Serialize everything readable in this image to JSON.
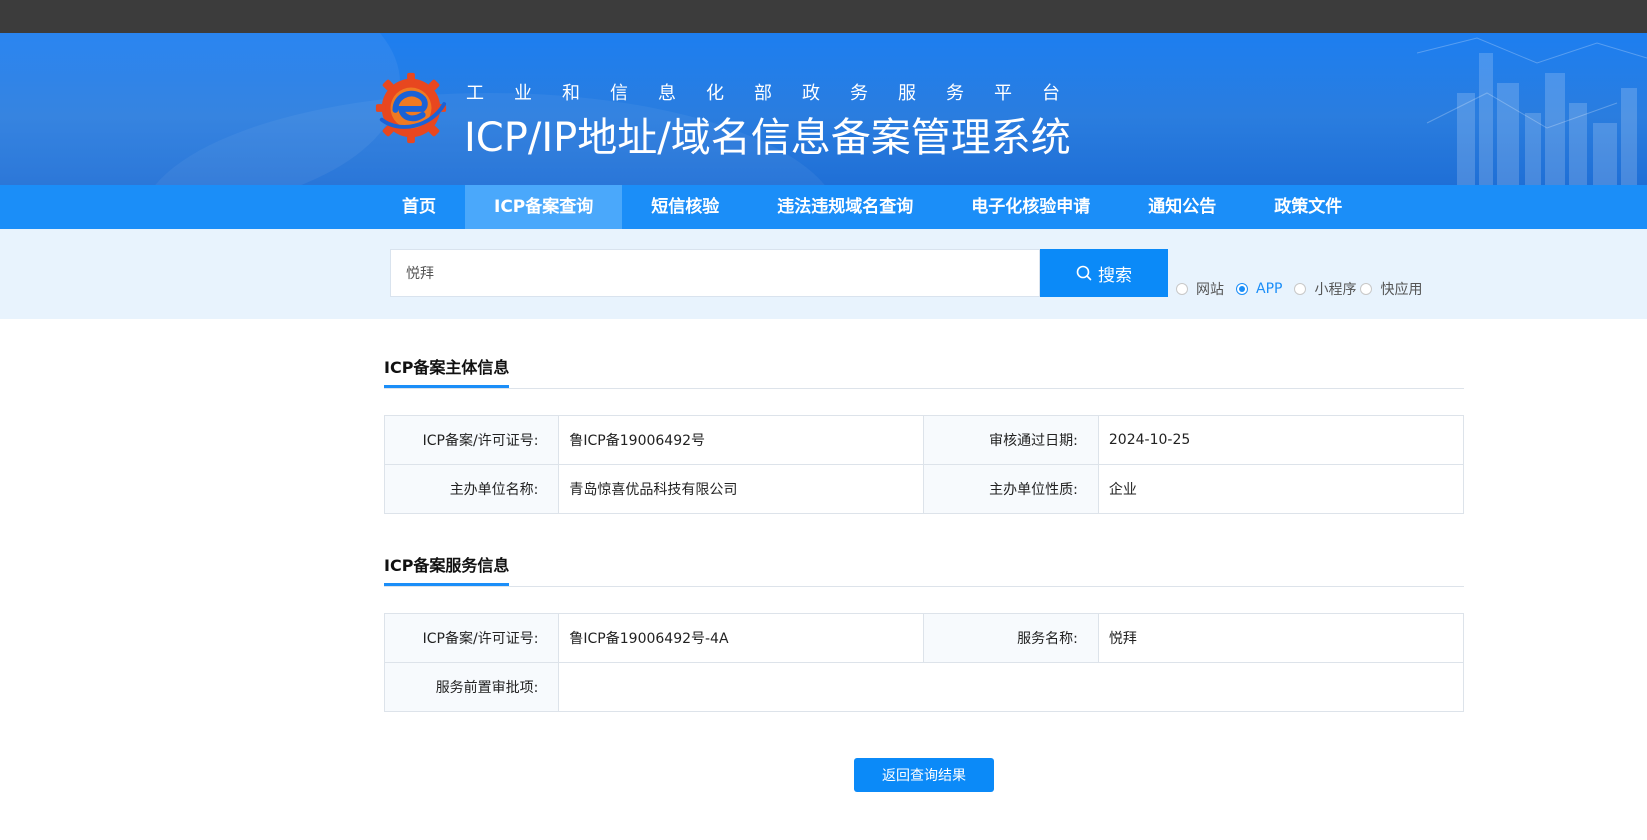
{
  "header": {
    "subtitle": "工业和信息化部政务服务平台",
    "title": "ICP/IP地址/域名信息备案管理系统"
  },
  "nav": {
    "items": [
      {
        "label": "首页"
      },
      {
        "label": "ICP备案查询",
        "active": true
      },
      {
        "label": "短信核验"
      },
      {
        "label": "违法违规域名查询"
      },
      {
        "label": "电子化核验申请"
      },
      {
        "label": "通知公告"
      },
      {
        "label": "政策文件"
      }
    ]
  },
  "search": {
    "value": "悦拜",
    "button_label": "搜索",
    "options": [
      {
        "label": "网站",
        "checked": false
      },
      {
        "label": "APP",
        "checked": true
      },
      {
        "label": "小程序",
        "checked": false
      },
      {
        "label": "快应用",
        "checked": false
      }
    ]
  },
  "entity": {
    "section_title": "ICP备案主体信息",
    "license_label": "ICP备案/许可证号:",
    "license_value": "鲁ICP备19006492号",
    "approve_date_label": "审核通过日期:",
    "approve_date_value": "2024-10-25",
    "org_name_label": "主办单位名称:",
    "org_name_value": "青岛惊喜优品科技有限公司",
    "org_type_label": "主办单位性质:",
    "org_type_value": "企业"
  },
  "service": {
    "section_title": "ICP备案服务信息",
    "license_label": "ICP备案/许可证号:",
    "license_value": "鲁ICP备19006492号-4A",
    "name_label": "服务名称:",
    "name_value": "悦拜",
    "pre_approval_label": "服务前置审批项:",
    "pre_approval_value": ""
  },
  "back_button": "返回查询结果",
  "colors": {
    "topbar": "#3c3c3c",
    "nav": "#1b8ef8",
    "nav_active": "#4aa8fb",
    "accent": "#0b8af8",
    "search_bg": "#e8f3fd"
  }
}
